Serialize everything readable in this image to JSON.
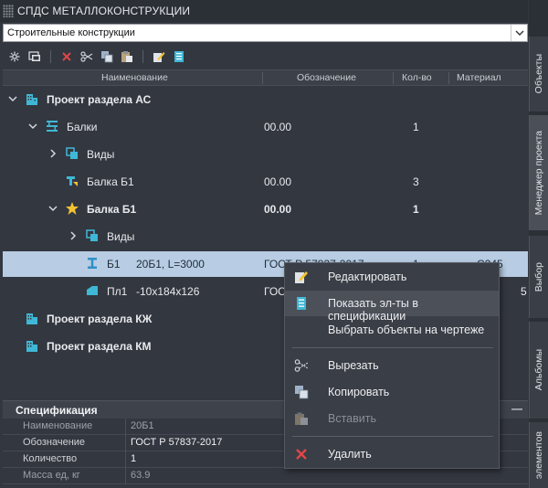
{
  "panel": {
    "title": "СПДС МЕТАЛЛОКОНСТРУКЦИИ"
  },
  "combo": {
    "value": "Строительные конструкции"
  },
  "columns": {
    "name": "Наименование",
    "designation": "Обозначение",
    "qty": "Кол-во",
    "material": "Материал"
  },
  "tree": [
    {
      "label": "Проект раздела АС",
      "designation": "",
      "qty": "",
      "bold": true
    },
    {
      "label": "Балки",
      "designation": "00.00",
      "qty": "1"
    },
    {
      "label": "Виды",
      "designation": "",
      "qty": ""
    },
    {
      "label": "Балка Б1",
      "designation": "00.00",
      "qty": "3"
    },
    {
      "label": "Балка Б1",
      "designation": "00.00",
      "qty": "1",
      "bold": true
    },
    {
      "label": "Виды",
      "designation": "",
      "qty": ""
    },
    {
      "label": "Б1",
      "label2": "20Б1, L=3000",
      "designation": "ГОСТ Р 57837-2017",
      "qty": "1",
      "material": "С245"
    },
    {
      "label": "Пл1",
      "label2": "-10x184x126",
      "designation": "ГОСТ",
      "qty": "",
      "material": "5"
    },
    {
      "label": "Проект раздела КЖ",
      "bold": true
    },
    {
      "label": "Проект раздела КМ",
      "bold": true
    }
  ],
  "spec": {
    "title": "Спецификация",
    "collapse": "—",
    "rows": [
      {
        "key": "Наименование",
        "value": "20Б1"
      },
      {
        "key": "Обозначение",
        "value": "ГОСТ Р 57837-2017"
      },
      {
        "key": "Количество",
        "value": "1"
      },
      {
        "key": "Масса ед, кг",
        "value": "63.9"
      }
    ]
  },
  "sidetabs": [
    "Объекты",
    "Менеджер проекта",
    "Выбор",
    "Альбомы",
    "элементов"
  ],
  "context_menu": [
    {
      "label": "Редактировать"
    },
    {
      "label": "Показать эл-ты в спецификации"
    },
    {
      "label": "Выбрать объекты на чертеже"
    },
    {
      "label": "Вырезать"
    },
    {
      "label": "Копировать"
    },
    {
      "label": "Вставить"
    },
    {
      "label": "Удалить"
    }
  ],
  "colors": {
    "selection": "#b8cde3",
    "accent": "#3fb8d6",
    "delete": "#e04646",
    "star": "#f2c230"
  }
}
